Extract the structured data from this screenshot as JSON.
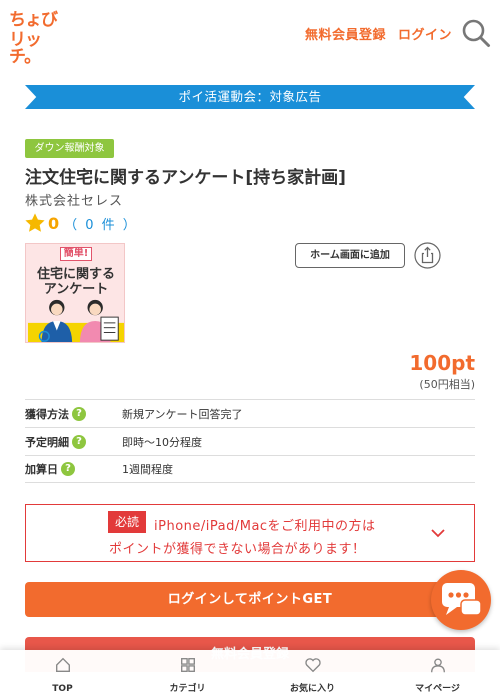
{
  "header": {
    "logo_line1": "ちょび",
    "logo_line2": "リッチ。",
    "register_link": "無料会員登録",
    "login_link": "ログイン",
    "search_icon": "search-icon"
  },
  "banner": {
    "text": "ポイ活運動会：対象広告"
  },
  "ad": {
    "badge": "ダウン報酬対象",
    "title": "注文住宅に関するアンケート[持ち家計画]",
    "company": "株式会社セレス",
    "rating_value": "0",
    "rating_count": "（ 0 件 ）",
    "thumbnail": {
      "badge": "簡単!",
      "line1": "住宅に関する",
      "line2": "アンケート"
    },
    "home_button": "ホーム画面に追加",
    "points": "100pt",
    "points_yen": "(50円相当)"
  },
  "info": {
    "rows": [
      {
        "label": "獲得方法",
        "value": "新規アンケート回答完了"
      },
      {
        "label": "予定明細",
        "value": "即時～10分程度"
      },
      {
        "label": "加算日",
        "value": "1週間程度"
      }
    ],
    "help_glyph": "?"
  },
  "warning": {
    "badge": "必読",
    "line1": "iPhone/iPad/Macをご利用中の方は",
    "line2": "ポイントが獲得できない場合があります！"
  },
  "buttons": {
    "login_get": "ログインしてポイントGET",
    "register": "無料会員登録"
  },
  "bottom_nav": {
    "items": [
      "TOP",
      "カテゴリ",
      "お気に入り",
      "マイページ"
    ]
  },
  "colors": {
    "brand": "#f26b2e",
    "banner": "#1a8fd8",
    "badge_green": "#8ec63f",
    "warning_red": "#e23a3a"
  }
}
